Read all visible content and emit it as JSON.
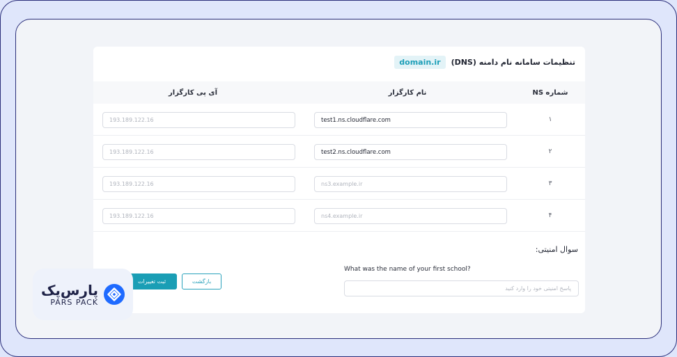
{
  "card": {
    "title": "تنظیمات سامانه نام دامنه (DNS)",
    "domain": "domain.ir"
  },
  "table": {
    "headers": {
      "ns": "شماره NS",
      "name": "نام کارگزار",
      "ip": "آی پی کارگزار"
    },
    "rows": [
      {
        "num": "۱",
        "name_value": "test1.ns.cloudflare.com",
        "name_placeholder": "",
        "ip_placeholder": "193.189.122.16"
      },
      {
        "num": "۲",
        "name_value": "test2.ns.cloudflare.com",
        "name_placeholder": "",
        "ip_placeholder": "193.189.122.16"
      },
      {
        "num": "۳",
        "name_value": "",
        "name_placeholder": "ns3.example.ir",
        "ip_placeholder": "193.189.122.16"
      },
      {
        "num": "۴",
        "name_value": "",
        "name_placeholder": "ns4.example.ir",
        "ip_placeholder": "193.189.122.16"
      }
    ]
  },
  "security": {
    "label": "سوال امنیتی:",
    "question": "What was the name of your first school?",
    "placeholder": "پاسخ امنیتی خود را وارد کنید"
  },
  "buttons": {
    "back": "بازگشت",
    "submit": "ثبت تغییرات"
  },
  "logo": {
    "fa": "پارس‌پک",
    "en": "PARS PACK"
  },
  "colors": {
    "accent": "#1a9eb5",
    "frame": "#2a2e7a",
    "logo_blue": "#1f6bff"
  }
}
